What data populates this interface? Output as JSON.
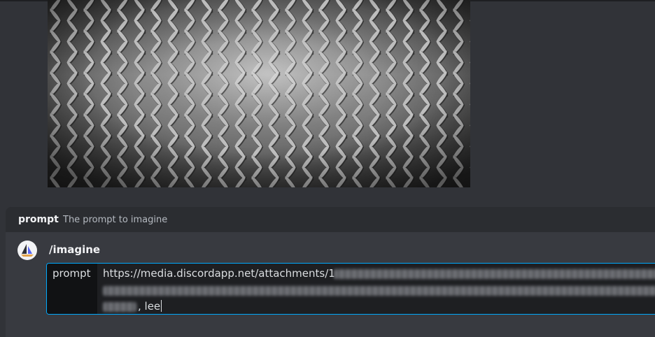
{
  "colors": {
    "background": "#313338",
    "hint_background": "#2b2d31",
    "command_background": "#383a40",
    "input_background": "#1e1f22",
    "focus_border": "#00a8fc"
  },
  "option_hint": {
    "option_name": "prompt",
    "option_description": "The prompt to imagine"
  },
  "command": {
    "name": "/imagine",
    "bot_avatar_icon": "sailboat-avatar-icon",
    "parameter": {
      "label": "prompt",
      "value_line_1": "https://media.discordapp.net/attachments/1",
      "value_line_3_end": ", lee"
    }
  }
}
